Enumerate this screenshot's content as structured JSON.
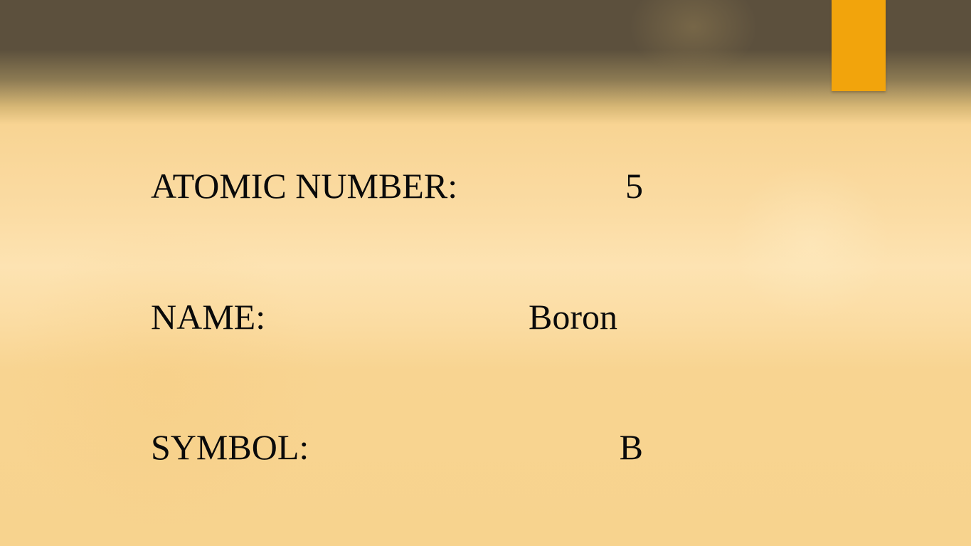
{
  "slide": {
    "accent_color": "#f2a40c",
    "fields": [
      {
        "label": "ATOMIC NUMBER:",
        "value": "5"
      },
      {
        "label": "NAME:",
        "value": "Boron"
      },
      {
        "label": "SYMBOL:",
        "value": "B"
      }
    ]
  }
}
